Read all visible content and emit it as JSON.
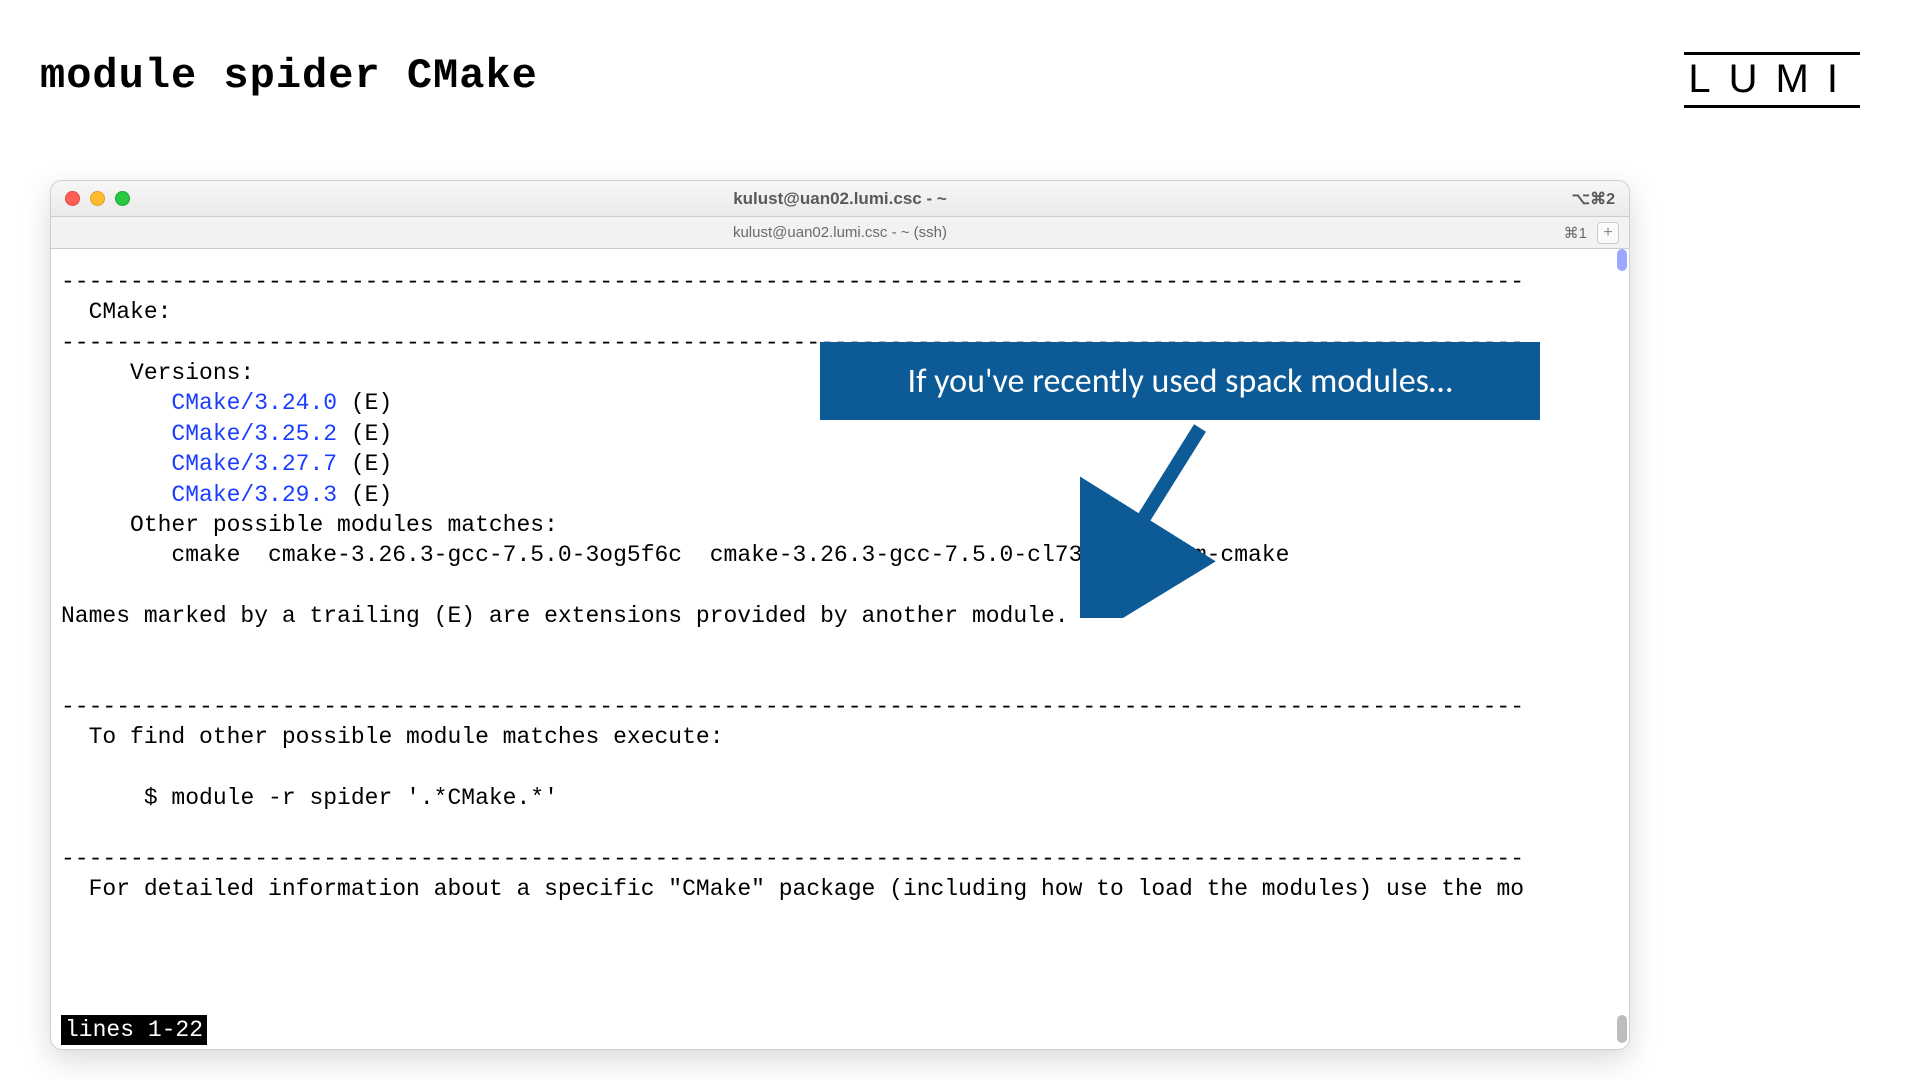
{
  "slide": {
    "title": "module spider CMake",
    "brand": "LUMI"
  },
  "window": {
    "title": "kulust@uan02.lumi.csc - ~",
    "right_indicator": "⌥⌘2",
    "tab_title": "kulust@uan02.lumi.csc - ~ (ssh)",
    "tab_right": "⌘1"
  },
  "terminal": {
    "dashline": "----------------------------------------------------------------------------------------------------------",
    "header_label": "CMake:",
    "versions_label": "Versions:",
    "versions": [
      {
        "name": "CMake/3.24.0",
        "suffix": " (E)"
      },
      {
        "name": "CMake/3.25.2",
        "suffix": " (E)"
      },
      {
        "name": "CMake/3.27.7",
        "suffix": " (E)"
      },
      {
        "name": "CMake/3.29.3",
        "suffix": " (E)"
      }
    ],
    "other_label": "Other possible modules matches:",
    "other_matches": "cmake  cmake-3.26.3-gcc-7.5.0-3og5f6c  cmake-3.26.3-gcc-7.5.0-cl73x27  rocm-cmake",
    "extensions_note": "Names marked by a trailing (E) are extensions provided by another module.",
    "find_other_label": "To find other possible module matches execute:",
    "find_other_cmd": "$ module -r spider '.*CMake.*'",
    "detail_line": "For detailed information about a specific \"CMake\" package (including how to load the modules) use the mo",
    "pager_status": "lines 1-22"
  },
  "callout": {
    "text": "If you've recently used spack modules…"
  },
  "colors": {
    "callout_bg": "#0c5a96",
    "module_blue": "#1a3cff"
  }
}
